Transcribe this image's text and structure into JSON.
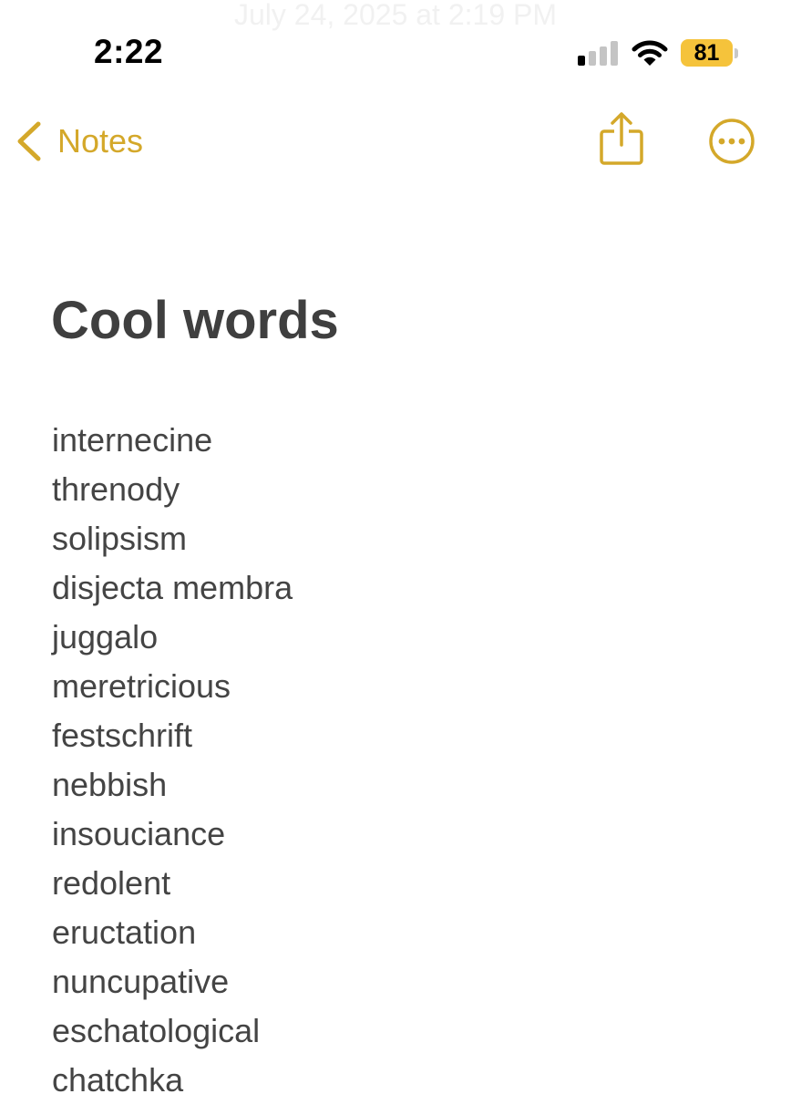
{
  "status_bar": {
    "time": "2:22",
    "battery_level": "81",
    "signal_bars_active": 1,
    "signal_bars_total": 4
  },
  "faded_header": {
    "date_text": "July 24, 2025 at 2:19 PM"
  },
  "nav": {
    "back_label": "Notes",
    "back_icon": "chevron-left-icon",
    "share_icon": "share-icon",
    "more_icon": "ellipsis-circle-icon"
  },
  "note": {
    "title": "Cool words",
    "words": [
      "internecine",
      "threnody",
      "solipsism",
      "disjecta membra",
      "juggalo",
      "meretricious",
      "festschrift",
      "nebbish",
      "insouciance",
      "redolent",
      "eructation",
      "nuncupative",
      "eschatological",
      "chatchka"
    ]
  },
  "colors": {
    "accent": "#d4a82a",
    "battery": "#f5c33b",
    "title_text": "#3f3f3f",
    "body_text": "#444444",
    "background": "#ffffff"
  }
}
